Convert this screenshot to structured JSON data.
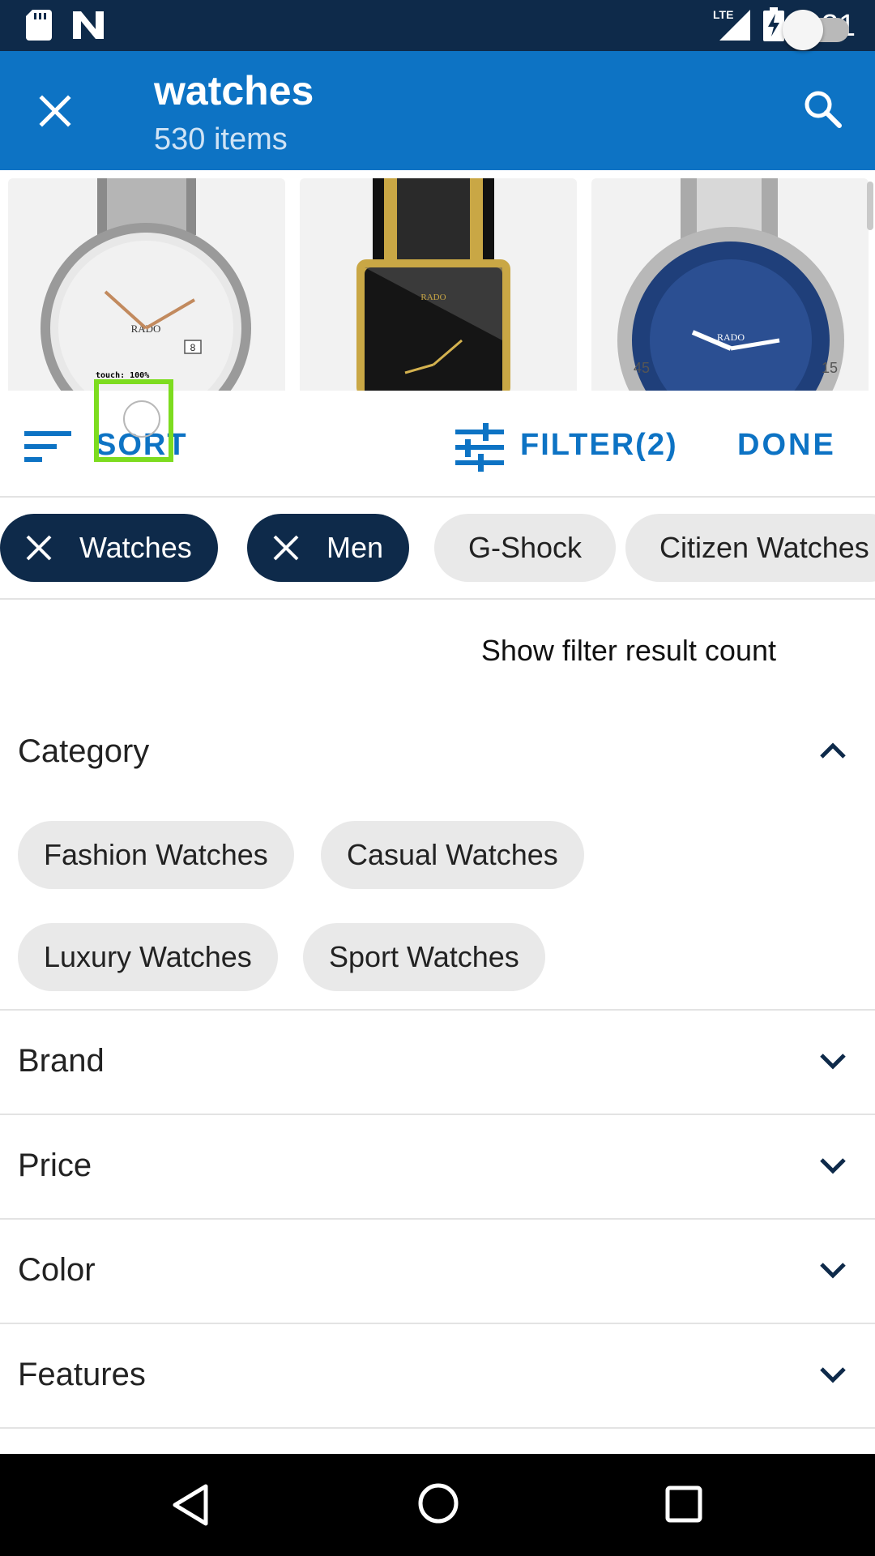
{
  "status_bar": {
    "time": "3:21",
    "network": "LTE",
    "icons": [
      "sd-card-icon",
      "n-logo-icon",
      "signal-icon",
      "battery-charging-icon"
    ]
  },
  "app_bar": {
    "title": "watches",
    "subtitle": "530 items",
    "icons": [
      "close-icon",
      "search-icon"
    ]
  },
  "products": [
    {
      "brand_text": "RADO",
      "style": "silver-rose-gold"
    },
    {
      "brand_text": "RADO",
      "style": "black-gold-square"
    },
    {
      "brand_text": "RADO",
      "style": "blue-diver"
    }
  ],
  "toolbar": {
    "sort_label": "SORT",
    "filter_label": "FILTER(2)",
    "done_label": "DONE"
  },
  "touch_overlay": {
    "text": "touch: 100%"
  },
  "active_chips": [
    {
      "label": "Watches"
    },
    {
      "label": "Men"
    }
  ],
  "suggested_chips": [
    {
      "label": "G-Shock"
    },
    {
      "label": "Citizen Watches"
    }
  ],
  "toggle": {
    "label": "Show filter result count",
    "on": false
  },
  "category": {
    "title": "Category",
    "expanded": true,
    "options": [
      {
        "label": "Fashion Watches"
      },
      {
        "label": "Casual Watches"
      },
      {
        "label": "Luxury Watches"
      },
      {
        "label": "Sport Watches"
      }
    ]
  },
  "sections": [
    {
      "title": "Brand"
    },
    {
      "title": "Price"
    },
    {
      "title": "Color"
    },
    {
      "title": "Features"
    }
  ],
  "colors": {
    "app_bar": "#0d73c4",
    "status_bar": "#0e2a4a",
    "active_chip": "#0e2a4a",
    "accent_text": "#0d73c4"
  }
}
